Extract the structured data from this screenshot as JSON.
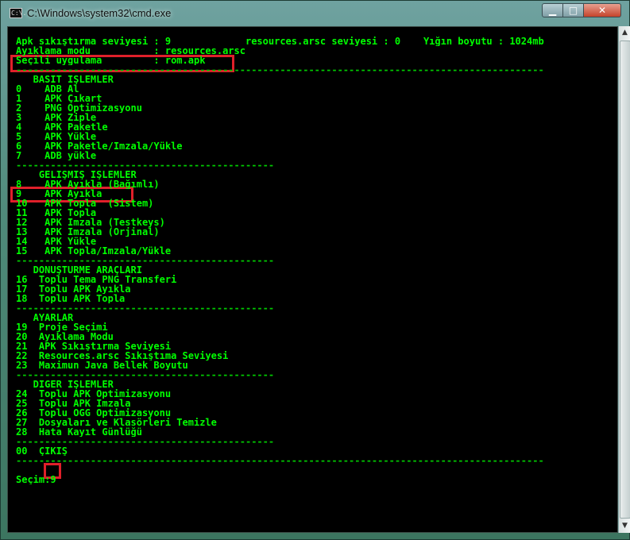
{
  "window": {
    "title": "C:\\Windows\\system32\\cmd.exe",
    "icon_label": "C:\\.",
    "controls": {
      "minimize": "▁",
      "maximize": "□",
      "close": "✕"
    }
  },
  "console": {
    "lines": [
      {
        "text": "Apk sıkıştırma seviyesi : 9             resources.arsc seviyesi : 0    Yığın boyutu : 1024mb",
        "kind": "header"
      },
      {
        "text": "Ayıklama modu           : resources.arsc",
        "kind": "header"
      },
      {
        "text": "Seçili uygulama         : rom.apk",
        "kind": "header"
      },
      {
        "text": "--------------------------------------------------------------------------------------------",
        "kind": "rule"
      },
      {
        "text": "   BASİT İŞLEMLER",
        "kind": "section"
      },
      {
        "text": "0    ADB Al",
        "kind": "item"
      },
      {
        "text": "1    APK Çıkart",
        "kind": "item"
      },
      {
        "text": "2    PNG Optimizasyonu",
        "kind": "item"
      },
      {
        "text": "3    APK Ziple",
        "kind": "item"
      },
      {
        "text": "4    APK Paketle",
        "kind": "item"
      },
      {
        "text": "5    APK Yükle",
        "kind": "item"
      },
      {
        "text": "6    APK Paketle/İmzala/Yükle",
        "kind": "item"
      },
      {
        "text": "7    ADB yükle",
        "kind": "item"
      },
      {
        "text": "---------------------------------------------",
        "kind": "rule"
      },
      {
        "text": "    GELİŞMİŞ İŞLEMLER",
        "kind": "section"
      },
      {
        "text": "8    APK Ayıkla (Bağımlı)",
        "kind": "item"
      },
      {
        "text": "9    APK Ayıkla",
        "kind": "item"
      },
      {
        "text": "10   APK Topla  (Sistem)",
        "kind": "item"
      },
      {
        "text": "11   APK Topla",
        "kind": "item"
      },
      {
        "text": "12   APK İmzala (Testkeys)",
        "kind": "item"
      },
      {
        "text": "13   APK İmzala (Orjinal)",
        "kind": "item"
      },
      {
        "text": "14   APK Yükle",
        "kind": "item"
      },
      {
        "text": "15   APK Topla/İmzala/Yükle",
        "kind": "item"
      },
      {
        "text": "---------------------------------------------",
        "kind": "rule"
      },
      {
        "text": "   DÖNÜŞTÜRME ARAÇLARI",
        "kind": "section"
      },
      {
        "text": "16  Toplu Tema PNG Transferi",
        "kind": "item"
      },
      {
        "text": "17  Toplu APK Ayıkla",
        "kind": "item"
      },
      {
        "text": "18  Toplu APK Topla",
        "kind": "item"
      },
      {
        "text": "---------------------------------------------",
        "kind": "rule"
      },
      {
        "text": "   AYARLAR",
        "kind": "section"
      },
      {
        "text": "19  Proje Seçimi",
        "kind": "item"
      },
      {
        "text": "20  Ayıklama Modu",
        "kind": "item"
      },
      {
        "text": "21  APK Sıkıştırma Seviyesi",
        "kind": "item"
      },
      {
        "text": "22  Resources.arsc Sıkıştıma Seviyesi",
        "kind": "item"
      },
      {
        "text": "23  Maximun Java Bellek Boyutu",
        "kind": "item"
      },
      {
        "text": "---------------------------------------------",
        "kind": "rule"
      },
      {
        "text": "   DİĞER İŞLEMLER",
        "kind": "section"
      },
      {
        "text": "24  Toplu APK Optimizasyonu",
        "kind": "item"
      },
      {
        "text": "25  Toplu APK İmzala",
        "kind": "item"
      },
      {
        "text": "26  Toplu OGG Optimizasyonu",
        "kind": "item"
      },
      {
        "text": "27  Dosyaları ve Klasörleri Temizle",
        "kind": "item"
      },
      {
        "text": "28  Hata Kayıt Günlüğü",
        "kind": "item"
      },
      {
        "text": "---------------------------------------------",
        "kind": "rule"
      },
      {
        "text": "00  ÇIKIŞ",
        "kind": "item"
      },
      {
        "text": "--------------------------------------------------------------------------------------------",
        "kind": "rule"
      },
      {
        "text": "",
        "kind": "blank"
      },
      {
        "text": "Seçim:9",
        "kind": "prompt"
      }
    ]
  },
  "highlight_color": "#e0202a",
  "text_color": "#00ff00"
}
